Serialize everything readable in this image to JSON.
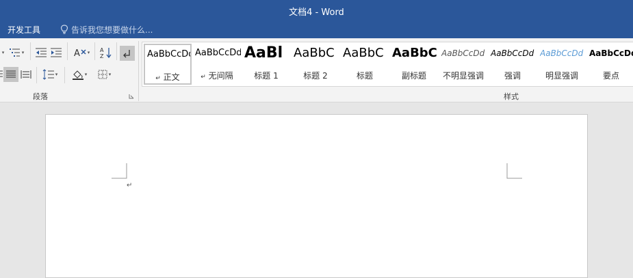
{
  "window": {
    "title": "文档4 - Word"
  },
  "menu": {
    "developer": "开发工具",
    "tell_me_placeholder": "告诉我您想要做什么..."
  },
  "ribbon": {
    "paragraph_group": "段落",
    "styles_group": "样式"
  },
  "styles": [
    {
      "preview": "AaBbCcDd",
      "name": "正文",
      "mark": "↵",
      "selected": true
    },
    {
      "preview": "AaBbCcDd",
      "name": "无间隔",
      "mark": "↵"
    },
    {
      "preview": "AaBl",
      "name": "标题 1"
    },
    {
      "preview": "AaBbC",
      "name": "标题 2"
    },
    {
      "preview": "AaBbC",
      "name": "标题"
    },
    {
      "preview": "AaBbC",
      "name": "副标题"
    },
    {
      "preview": "AaBbCcDd",
      "name": "不明显强调"
    },
    {
      "preview": "AaBbCcDd",
      "name": "强调"
    },
    {
      "preview": "AaBbCcDd",
      "name": "明显强调"
    },
    {
      "preview": "AaBbCcDd",
      "name": "要点"
    }
  ],
  "document": {
    "paragraph_mark": "↵"
  },
  "icons": {
    "tell_me": "lightbulb-icon",
    "sort": "sort-az-icon",
    "show_marks": "paragraph-mark-icon"
  },
  "colors": {
    "title_bar": "#2b579a",
    "ribbon": "#f3f3f3",
    "accent_style": "#5b9bd5"
  }
}
